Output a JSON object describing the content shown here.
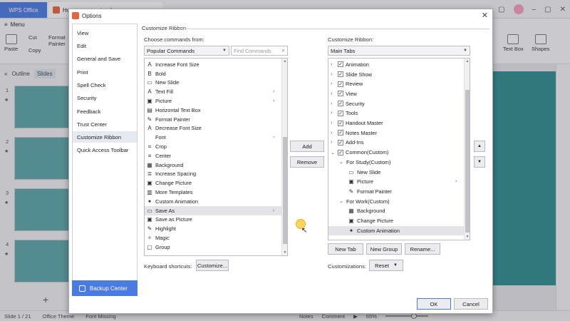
{
  "app": {
    "wps_tab": "WPS Office",
    "doc_tab": "How to customize the",
    "menu_label": "Menu",
    "ribbon": {
      "paste": "Paste",
      "cut": "Cut",
      "copy": "Copy",
      "format_painter": "Format Painter",
      "text_box": "Text Box",
      "shapes": "Shapes"
    },
    "left_tabs": [
      "Outline",
      "Slides"
    ],
    "slide_numbers": [
      "1",
      "2",
      "3",
      "4"
    ],
    "status": {
      "slide": "Slide 1 / 21",
      "theme": "Office Theme",
      "font_missing": "Font Missing",
      "notes": "Notes",
      "comment": "Comment",
      "zoom": "65%"
    }
  },
  "dialog": {
    "title": "Options",
    "nav": [
      "View",
      "Edit",
      "General and Save",
      "Print",
      "Spell Check",
      "Security",
      "Feedback",
      "Trust Center",
      "Customize Ribbon",
      "Quick Access Toolbar"
    ],
    "nav_active": "Customize Ribbon",
    "backup_center": "Backup Center",
    "group_label": "Customize Ribbon",
    "choose_label": "Choose commands from:",
    "choose_value": "Popular Commands",
    "find_placeholder": "Find Commands",
    "commands": [
      {
        "label": "Increase Font Size",
        "icon": "A"
      },
      {
        "label": "Bold",
        "icon": "B"
      },
      {
        "label": "New Slide",
        "icon": "▭"
      },
      {
        "label": "Text Fill",
        "icon": "A",
        "submenu": true
      },
      {
        "label": "Picture",
        "icon": "▣",
        "submenu": true
      },
      {
        "label": "Horizontal Text Box",
        "icon": "▤"
      },
      {
        "label": "Format  Painter",
        "icon": "✎"
      },
      {
        "label": "Decrease Font Size",
        "icon": "A"
      },
      {
        "label": "Font",
        "icon": ""
      },
      {
        "label": "Crop",
        "icon": "⌗"
      },
      {
        "label": "Center",
        "icon": "≡"
      },
      {
        "label": "Background",
        "icon": "▦"
      },
      {
        "label": "Increase Spacing",
        "icon": "≣"
      },
      {
        "label": "Change Picture",
        "icon": "▣"
      },
      {
        "label": "More Templates",
        "icon": "▥"
      },
      {
        "label": "Custom Animation",
        "icon": "✦"
      },
      {
        "label": "Save As",
        "icon": "▭",
        "submenu": true,
        "selected": true
      },
      {
        "label": "Save as Picture",
        "icon": "▣"
      },
      {
        "label": "Highlight",
        "icon": "✎"
      },
      {
        "label": "Magic",
        "icon": "✧"
      },
      {
        "label": "Group",
        "icon": "▢"
      }
    ],
    "add_button": "Add",
    "remove_button": "Remove",
    "ribbon_label": "Customize Ribbon:",
    "ribbon_value": "Main Tabs",
    "tabs_tree": [
      {
        "label": "Animation",
        "level": 0,
        "check": true,
        "chevron": "›"
      },
      {
        "label": "Slide Show",
        "level": 0,
        "check": true,
        "chevron": "›"
      },
      {
        "label": "Review",
        "level": 0,
        "check": true,
        "chevron": "›"
      },
      {
        "label": "View",
        "level": 0,
        "check": true,
        "chevron": "›"
      },
      {
        "label": "Security",
        "level": 0,
        "check": true,
        "chevron": "›"
      },
      {
        "label": "Tools",
        "level": 0,
        "check": true,
        "chevron": "›"
      },
      {
        "label": "Handout Master",
        "level": 0,
        "check": true,
        "chevron": "›"
      },
      {
        "label": "Notes Master",
        "level": 0,
        "check": true,
        "chevron": "›"
      },
      {
        "label": "Add-Ins",
        "level": 0,
        "check": true,
        "chevron": "›"
      },
      {
        "label": "Common(Custom)",
        "level": 0,
        "check": true,
        "chevron": "⌄"
      },
      {
        "label": "For Study(Custom)",
        "level": 1,
        "check": false,
        "chevron": "⌄"
      },
      {
        "label": "New Slide",
        "level": 2,
        "icon": "▭"
      },
      {
        "label": "Picture",
        "level": 2,
        "icon": "▣",
        "submenu": true
      },
      {
        "label": "Format  Painter",
        "level": 2,
        "icon": "✎"
      },
      {
        "label": "For Work(Custom)",
        "level": 1,
        "check": false,
        "chevron": "⌄"
      },
      {
        "label": "Background",
        "level": 2,
        "icon": "▦"
      },
      {
        "label": "Change Picture",
        "level": 2,
        "icon": "▣"
      },
      {
        "label": "Custom Animation",
        "level": 2,
        "icon": "✦",
        "selected": true
      }
    ],
    "new_tab": "New Tab",
    "new_group": "New Group",
    "rename": "Rename...",
    "keyboard_label": "Keyboard shortcuts:",
    "customize_btn": "Customize...",
    "customizations_label": "Customizations:",
    "reset_btn": "Reset",
    "ok": "OK",
    "cancel": "Cancel"
  },
  "colors": {
    "accent": "#4a7be4",
    "slide_teal": "#5aa6a8"
  }
}
